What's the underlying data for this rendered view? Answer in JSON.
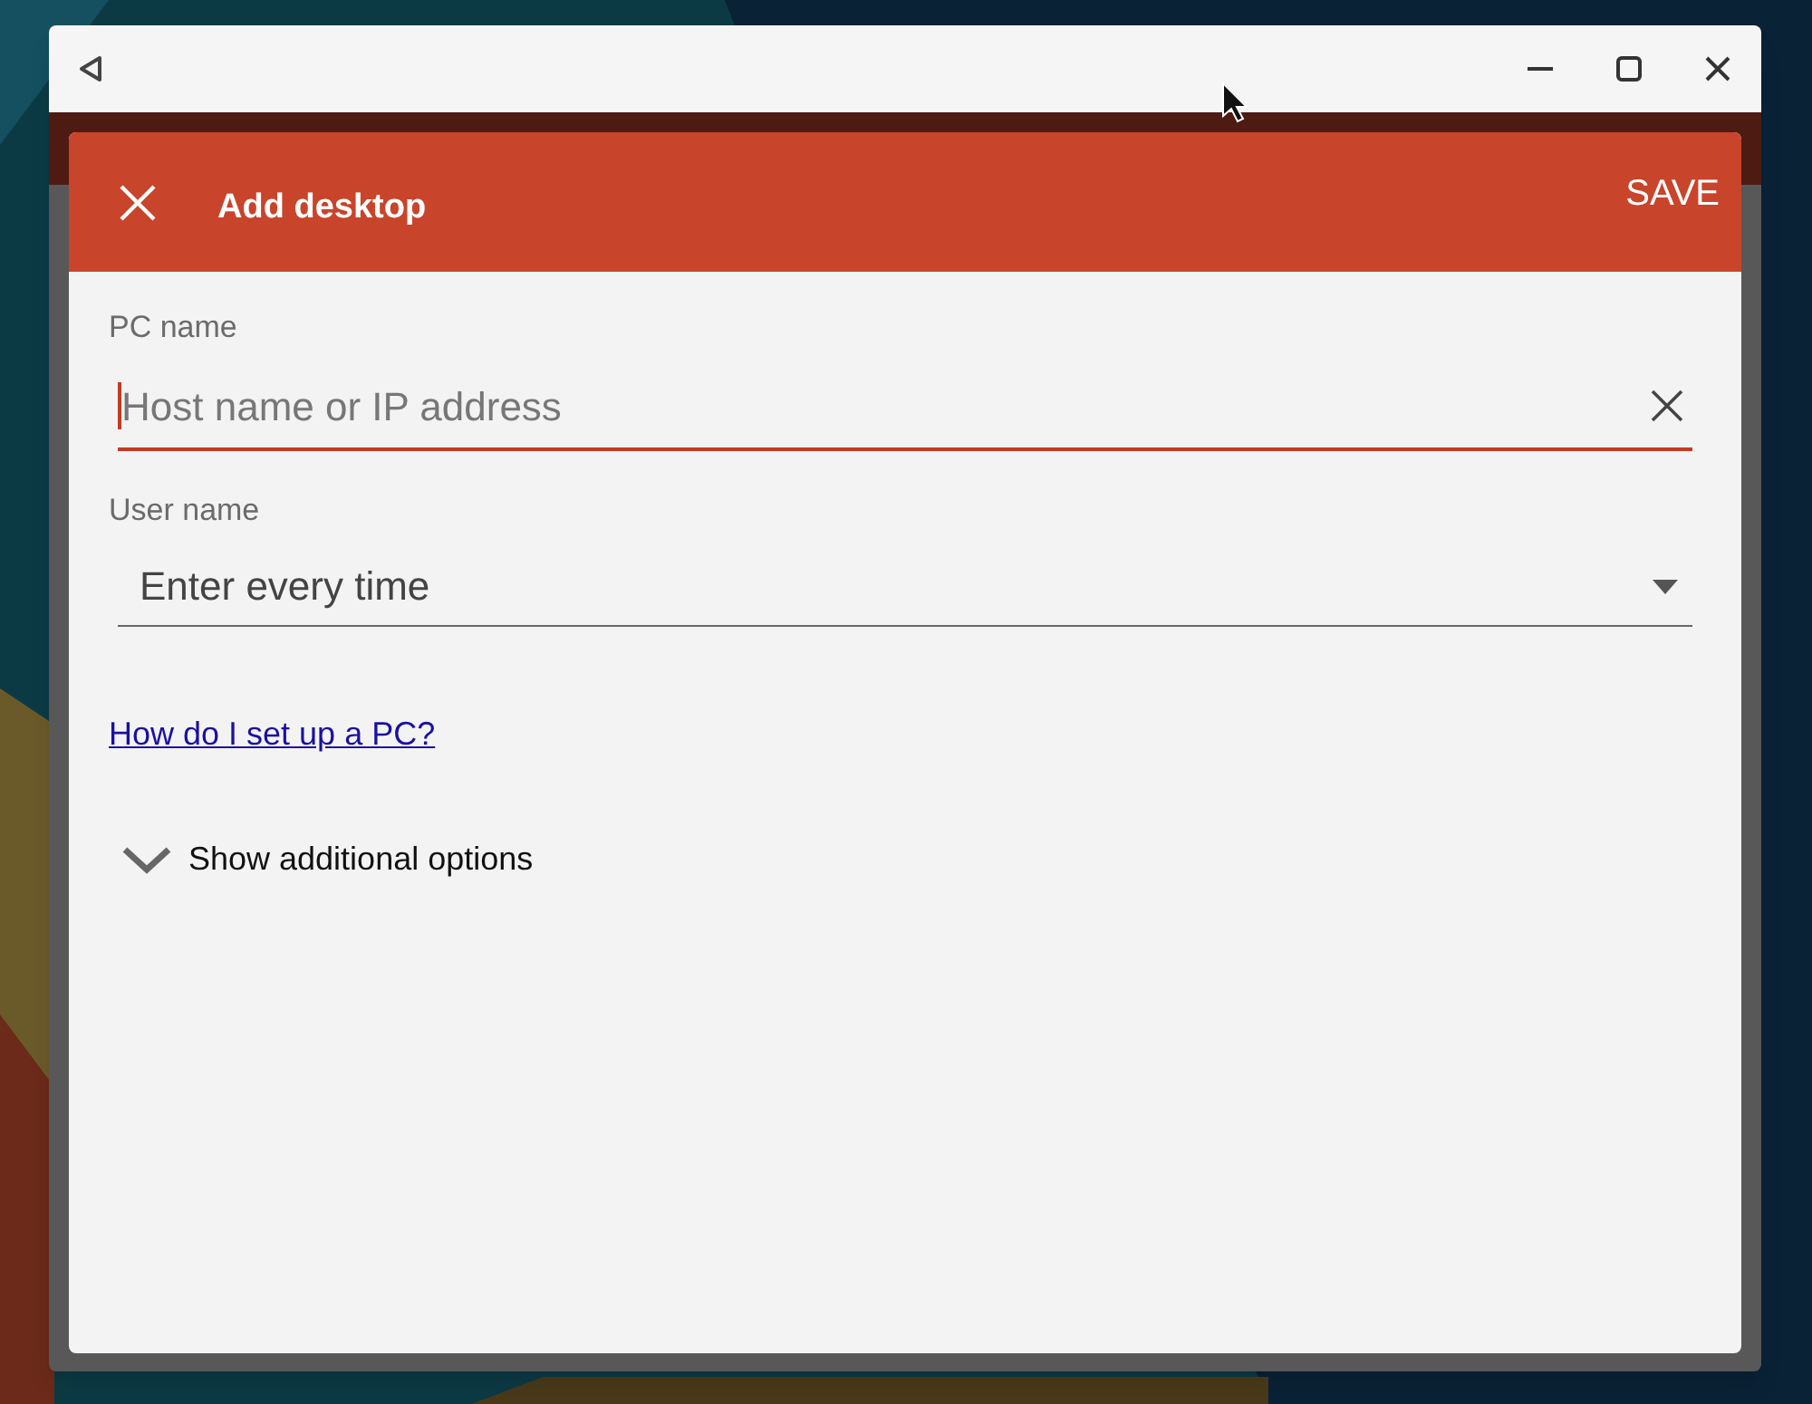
{
  "dialog": {
    "title": "Add desktop",
    "save": "SAVE"
  },
  "fields": [
    {
      "kind": "text",
      "label": "PC name",
      "placeholder": "Host name or IP address"
    },
    {
      "kind": "select",
      "label": "User name",
      "value": "Enter every time"
    }
  ],
  "help_link": "How do I set up a PC?",
  "options_toggle": {
    "label": "Show additional options",
    "expanded": false
  }
}
